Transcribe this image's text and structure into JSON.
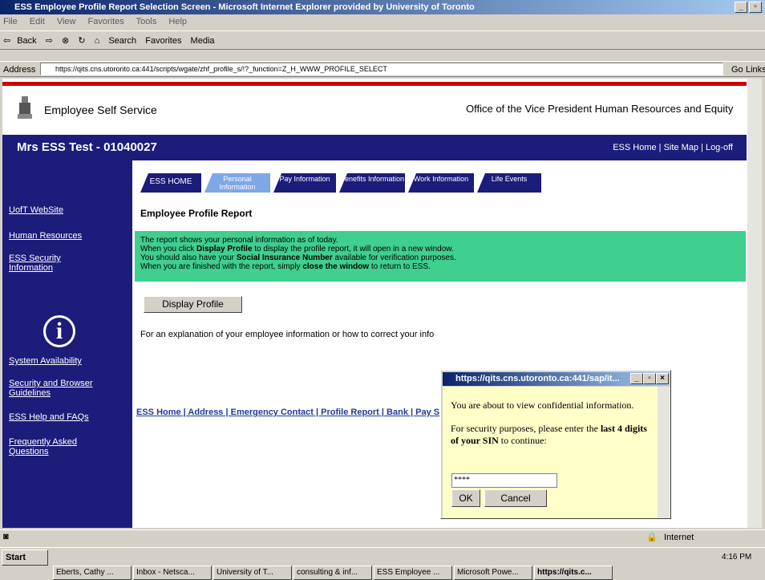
{
  "window": {
    "title": "ESS Employee Profile Report Selection Screen - Microsoft Internet Explorer provided by University of Toronto",
    "menu": [
      "File",
      "Edit",
      "View",
      "Favorites",
      "Tools",
      "Help"
    ],
    "toolbar": [
      "Back",
      "Search",
      "Favorites",
      "Media"
    ],
    "address_label": "Address",
    "address_url": "https://qits.cns.utoronto.ca:441/scripts/wgate/zhf_profile_s/!?_function=Z_H_WWW_PROFILE_SELECT",
    "go_label": "Go",
    "links_label": "Links"
  },
  "header": {
    "app_title": "Employee Self Service",
    "office": "Office of the Vice President Human Resources and Equity",
    "user": "Mrs ESS Test - 01040027",
    "top_links": "ESS Home | Site Map | Log-off"
  },
  "sidebar": {
    "links": [
      "UofT WebSite",
      "Human Resources",
      "ESS Security Information",
      "System Availability",
      "Security and Browser Guidelines",
      "ESS Help and FAQs",
      "Frequently Asked Questions"
    ]
  },
  "tabs": [
    {
      "label": "ESS HOME"
    },
    {
      "label": "Personal Information"
    },
    {
      "label": "Pay Information"
    },
    {
      "label": "Benefits Information"
    },
    {
      "label": "Work Information"
    },
    {
      "label": "Life Events"
    }
  ],
  "main": {
    "title": "Employee Profile Report",
    "info_line1": "The report shows your personal information as of today.",
    "info_line2_a": "When you click ",
    "info_line2_b": "Display Profile",
    "info_line2_c": " to display the profile report, it will open in a new window.",
    "info_line3_a": "You should also have your ",
    "info_line3_b": "Social Insurance Number",
    "info_line3_c": " available for verification purposes.",
    "info_line4_a": "When you are finished with the report, simply ",
    "info_line4_b": "close the window",
    "info_line4_c": " to return to ESS.",
    "display_button": "Display Profile",
    "explain": "For an explanation of your employee information or how to correct your info",
    "bottom_links": "ESS Home | Address | Emergency Contact | Profile Report | Bank | Pay S"
  },
  "dialog": {
    "title": "https://qits.cns.utoronto.ca:441/sap/it...",
    "msg1": "You are about to view confidential information.",
    "msg2_a": "For security purposes, please enter the ",
    "msg2_b": "last 4 digits of your SIN",
    "msg2_c": " to continue:",
    "input_value": "****",
    "ok": "OK",
    "cancel": "Cancel"
  },
  "status": {
    "zone": "Internet"
  },
  "taskbar": {
    "start": "Start",
    "tasks": [
      "Eberts, Cathy ...",
      "Inbox - Netsca...",
      "University of T...",
      "consulting & inf...",
      "ESS Employee ...",
      "Microsoft Powe...",
      "https://qits.c..."
    ],
    "clock": "4:16 PM"
  }
}
